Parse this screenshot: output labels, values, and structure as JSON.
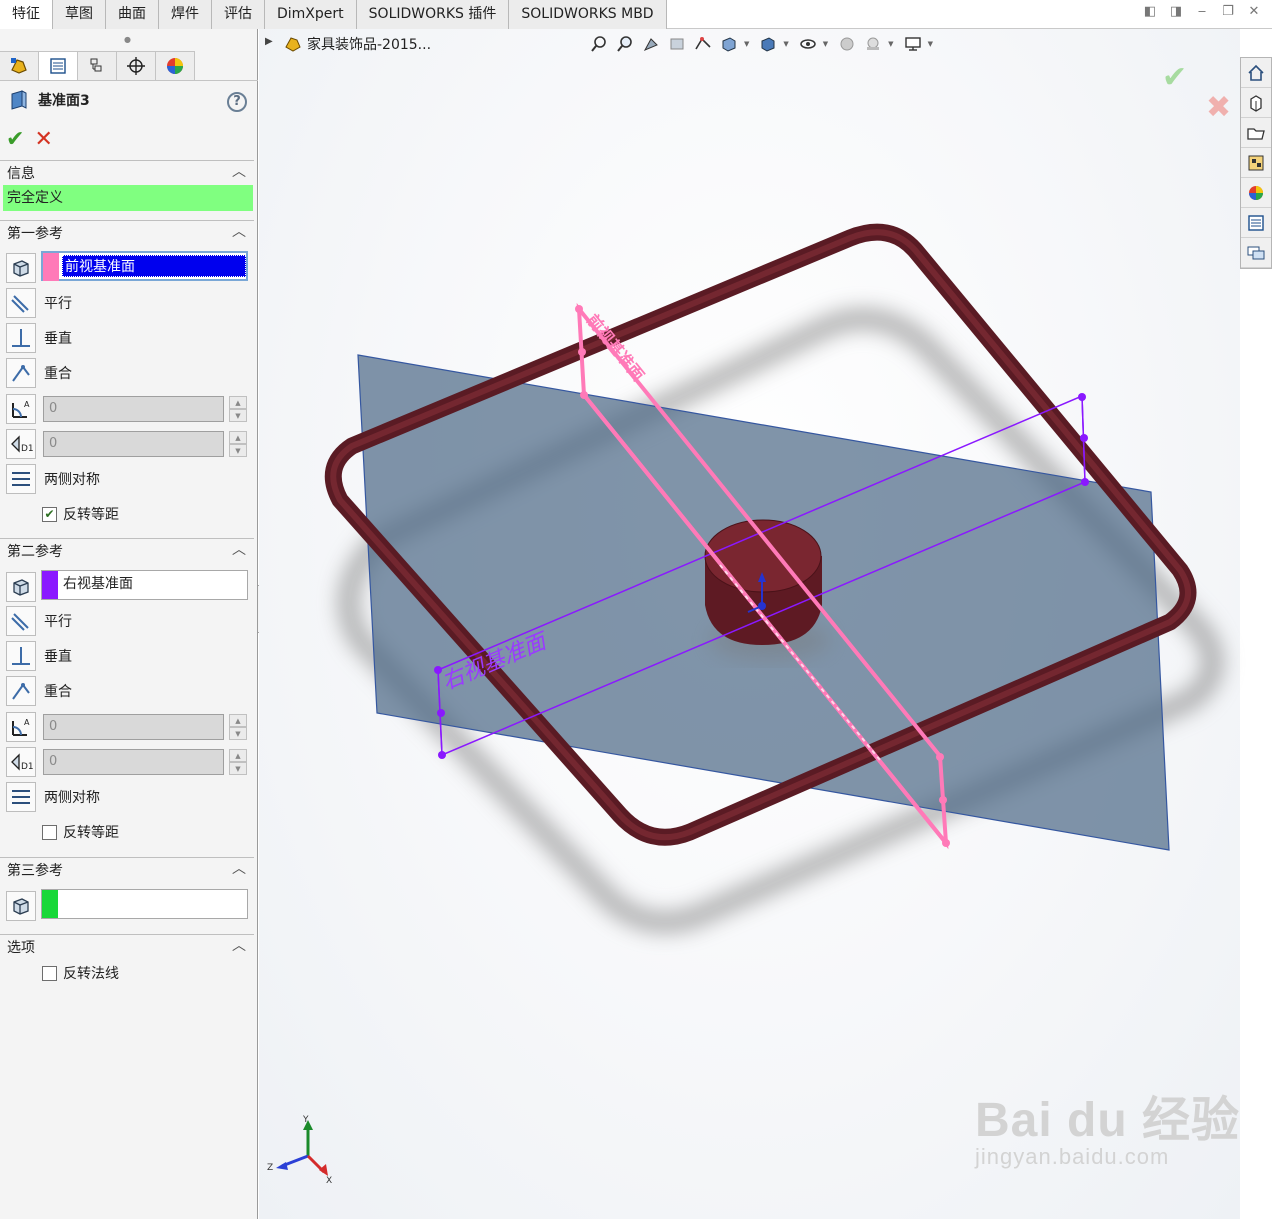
{
  "tabs": [
    "特征",
    "草图",
    "曲面",
    "焊件",
    "评估",
    "DimXpert",
    "SOLIDWORKS 插件",
    "SOLIDWORKS MBD"
  ],
  "active_tab": "特征",
  "window_buttons": [
    "◧",
    "◨",
    "‒",
    "❐",
    "✕"
  ],
  "panel": {
    "title": "基准面3",
    "help": "?",
    "info_section": "信息",
    "status": "完全定义",
    "status_color": "#80ff80",
    "first_ref": {
      "header": "第一参考",
      "value": "前视基准面",
      "color": "#ff7ab8",
      "parallel": "平行",
      "perpendicular": "垂直",
      "coincident": "重合",
      "angle": "0",
      "distance": "0",
      "mid_plane": "两侧对称",
      "flip_offset": "反转等距",
      "flip_checked": true
    },
    "second_ref": {
      "header": "第二参考",
      "value": "右视基准面",
      "color": "#8a18ff",
      "parallel": "平行",
      "perpendicular": "垂直",
      "coincident": "重合",
      "angle": "0",
      "distance": "0",
      "mid_plane": "两侧对称",
      "flip_offset": "反转等距",
      "flip_checked": false
    },
    "third_ref": {
      "header": "第三参考",
      "value": "",
      "color": "#18d838"
    },
    "options": {
      "header": "选项",
      "flip_normal": "反转法线"
    }
  },
  "tree_item": "家具装饰品-2015...",
  "plane_labels": {
    "front": "前视基准面",
    "right": "右视基准面"
  },
  "triad": {
    "x": "X",
    "y": "Y",
    "z": "Z"
  },
  "watermark": {
    "main": "Bai du 经验",
    "sub": "jingyan.baidu.com"
  }
}
